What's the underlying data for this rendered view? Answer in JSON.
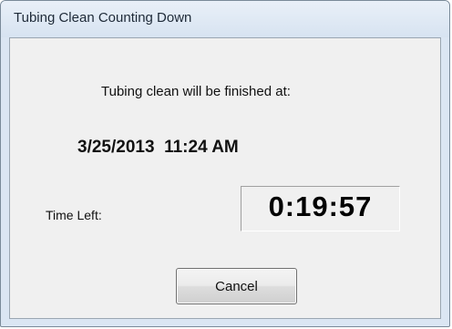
{
  "window": {
    "title": "Tubing Clean Counting Down"
  },
  "dialog": {
    "finish_label": "Tubing clean will be finished at:",
    "finish_time": "3/25/2013  11:24 AM",
    "time_left_label": "Time Left:",
    "countdown": "0:19:57",
    "cancel_label": "Cancel"
  }
}
